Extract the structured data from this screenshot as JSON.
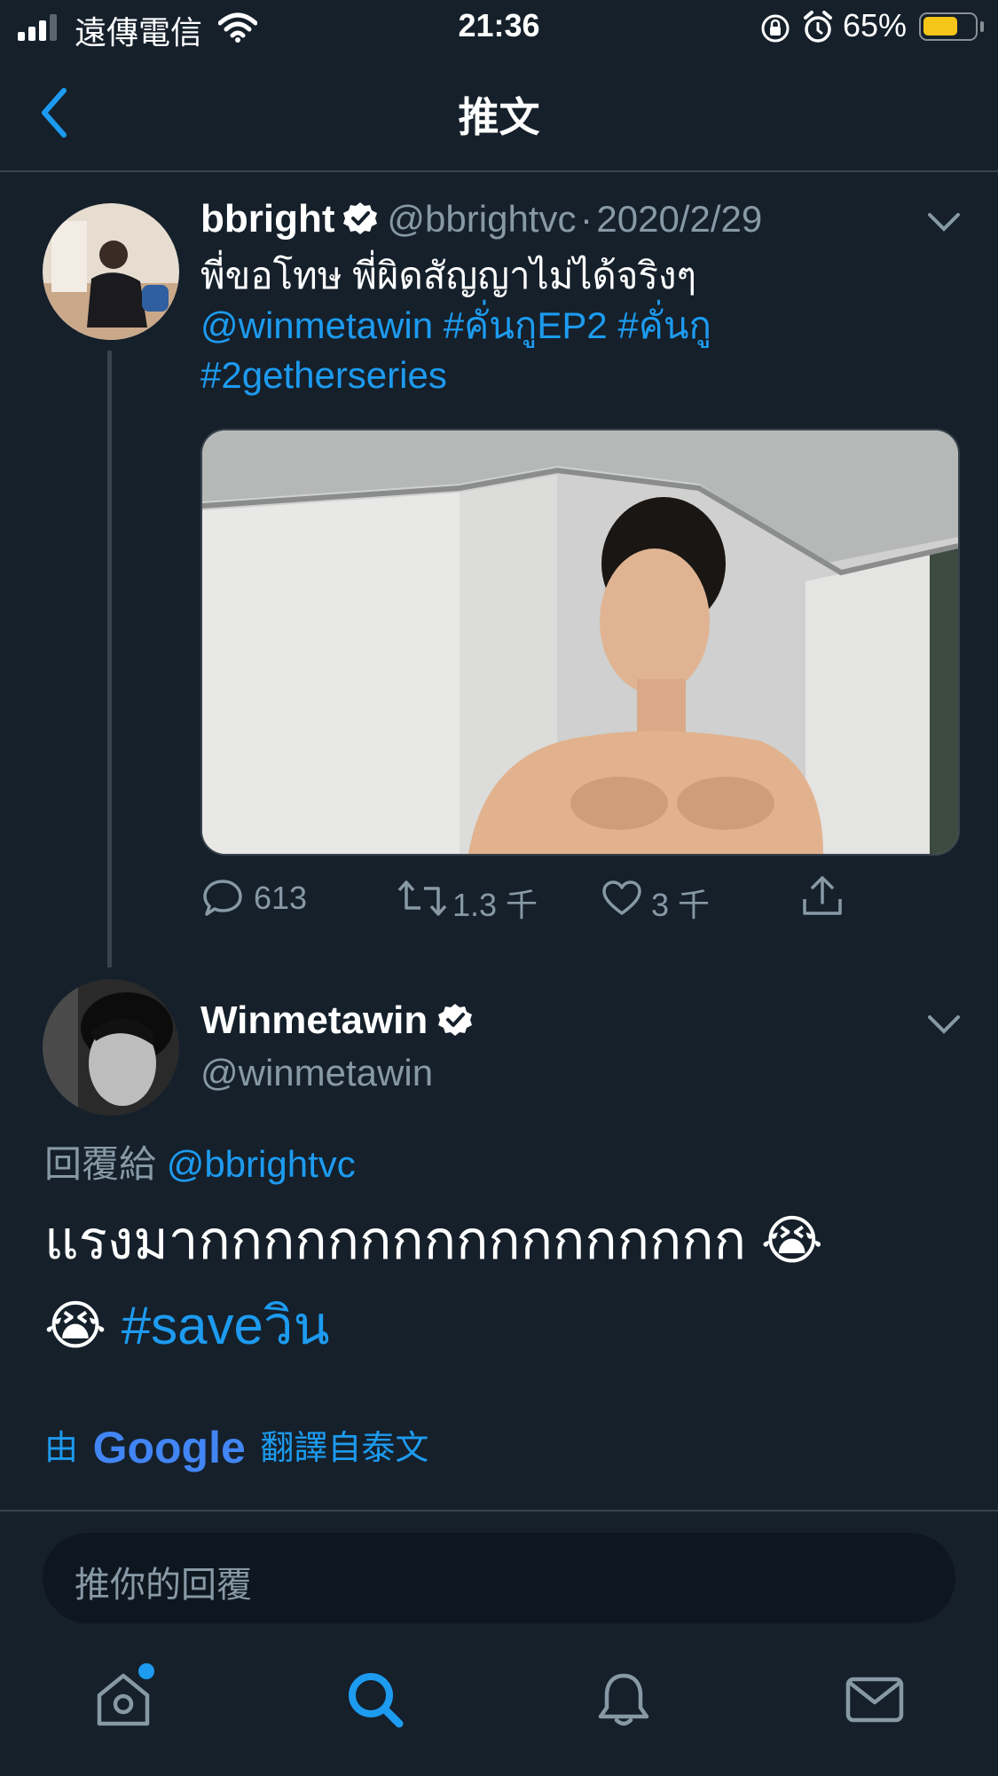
{
  "status_bar": {
    "carrier": "遠傳電信",
    "time": "21:36",
    "battery": "65%"
  },
  "header": {
    "title": "推文",
    "back_icon": "chevron-left-icon"
  },
  "tweet1": {
    "name": "bbright",
    "handle": "@bbrightvc",
    "separator": "·",
    "date": "2020/2/29",
    "text_line1": "พี่ขอโทษ พี่ผิดสัญญาไม่ได้จริงๆ",
    "mention": "@winmetawin",
    "hashtag1": "#คั่นกูEP2",
    "hashtag2": "#คั่นกู",
    "hashtag3": "#2getherseries",
    "stats": {
      "replies": "613",
      "retweets": "1.3 千",
      "likes": "3 千"
    }
  },
  "tweet2": {
    "name": "Winmetawin",
    "handle": "@winmetawin",
    "reply_prefix": "回覆給",
    "reply_handle": "@bbrightvc",
    "text_main": "แรงมากกกกกกกกกกกกกกกกก",
    "emoji": "😭",
    "hashtag": "#saveวิน",
    "translate_prefix": "由",
    "translate_brand": "Google",
    "translate_suffix": "翻譯自泰文"
  },
  "reply_box": {
    "placeholder": "推你的回覆"
  },
  "colors": {
    "background": "#15202b",
    "accent": "#1d9bf0",
    "secondary_text": "#8899a6",
    "divider": "#38444d",
    "battery": "#f5c518"
  },
  "bottom_nav": {
    "items": [
      "home-icon",
      "search-icon",
      "notifications-icon",
      "messages-icon"
    ],
    "active": "search-icon"
  }
}
